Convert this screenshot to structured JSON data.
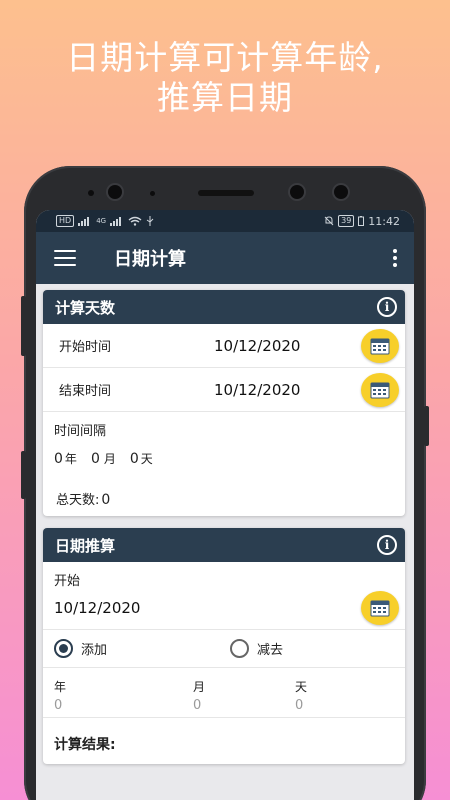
{
  "promo": {
    "line1": "日期计算可计算年龄,",
    "line2": "推算日期"
  },
  "status": {
    "left_badge": "HD",
    "network": "4G",
    "battery": "39",
    "time": "11:42"
  },
  "appbar": {
    "title": "日期计算"
  },
  "card1": {
    "title": "计算天数",
    "start_label": "开始时间",
    "start_value": "10/12/2020",
    "end_label": "结束时间",
    "end_value": "10/12/2020",
    "interval_label": "时间间隔",
    "years": "0",
    "years_unit": "年",
    "months": "0",
    "months_unit": "月",
    "days": "0",
    "days_unit": "天",
    "total_label": "总天数:",
    "total_value": "0"
  },
  "card2": {
    "title": "日期推算",
    "start_label": "开始",
    "start_value": "10/12/2020",
    "add_label": "添加",
    "subtract_label": "减去",
    "year_label": "年",
    "month_label": "月",
    "day_label": "天",
    "year_placeholder": "0",
    "month_placeholder": "0",
    "day_placeholder": "0",
    "result_label": "计算结果:"
  },
  "colors": {
    "primary": "#2b3e50",
    "accent": "#f7cf2a",
    "bg": "#e9e9ec"
  }
}
